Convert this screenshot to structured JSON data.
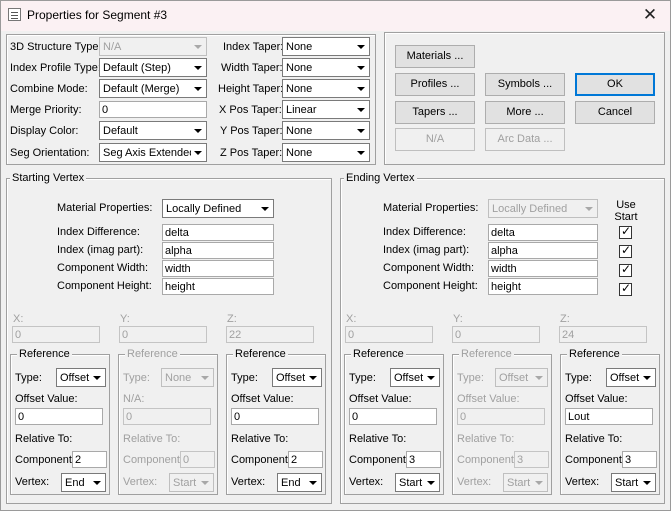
{
  "window": {
    "title": "Properties for Segment #3",
    "close_glyph": "✕"
  },
  "segment": {
    "labels": {
      "structure_type": "3D Structure Type:",
      "index_profile_type": "Index Profile Type:",
      "combine_mode": "Combine Mode:",
      "merge_priority": "Merge Priority:",
      "display_color": "Display Color:",
      "seg_orientation": "Seg Orientation:",
      "index_taper": "Index Taper:",
      "width_taper": "Width Taper:",
      "height_taper": "Height Taper:",
      "x_pos_taper": "X Pos Taper:",
      "y_pos_taper": "Y Pos Taper:",
      "z_pos_taper": "Z Pos Taper:"
    },
    "values": {
      "structure_type": "N/A",
      "index_profile_type": "Default (Step)",
      "combine_mode": "Default (Merge)",
      "merge_priority": "0",
      "display_color": "Default",
      "seg_orientation": "Seg Axis Extended",
      "index_taper": "None",
      "width_taper": "None",
      "height_taper": "None",
      "x_pos_taper": "Linear",
      "y_pos_taper": "None",
      "z_pos_taper": "None"
    }
  },
  "buttons": {
    "materials": "Materials ...",
    "profiles": "Profiles ...",
    "symbols": "Symbols ...",
    "ok": "OK",
    "tapers": "Tapers ...",
    "more": "More ...",
    "cancel": "Cancel",
    "na": "N/A",
    "arc_data": "Arc Data ..."
  },
  "starting_vertex": {
    "title": "Starting Vertex",
    "material_properties_label": "Material Properties:",
    "material_properties": "Locally Defined",
    "index_difference_label": "Index Difference:",
    "index_difference": "delta",
    "index_imag_label": "Index (imag part):",
    "index_imag": "alpha",
    "component_width_label": "Component Width:",
    "component_width": "width",
    "component_height_label": "Component Height:",
    "component_height": "height",
    "x_label": "X:",
    "x": "0",
    "y_label": "Y:",
    "y": "0",
    "z_label": "Z:",
    "z": "22",
    "refs": [
      {
        "title": "Reference",
        "type_label": "Type:",
        "type": "Offset",
        "value_label": "Offset Value:",
        "value": "0",
        "relative_label": "Relative To:",
        "component_label": "Component:",
        "component": "2",
        "vertex_label": "Vertex:",
        "vertex": "End"
      },
      {
        "title": "Reference",
        "type_label": "Type:",
        "type": "None",
        "value_label": "N/A:",
        "value": "0",
        "relative_label": "Relative To:",
        "component_label": "Component:",
        "component": "0",
        "vertex_label": "Vertex:",
        "vertex": "Start"
      },
      {
        "title": "Reference",
        "type_label": "Type:",
        "type": "Offset",
        "value_label": "Offset Value:",
        "value": "0",
        "relative_label": "Relative To:",
        "component_label": "Component:",
        "component": "2",
        "vertex_label": "Vertex:",
        "vertex": "End"
      }
    ]
  },
  "ending_vertex": {
    "title": "Ending Vertex",
    "use_start_label": "Use Start",
    "material_properties_label": "Material Properties:",
    "material_properties": "Locally Defined",
    "index_difference_label": "Index Difference:",
    "index_difference": "delta",
    "index_imag_label": "Index (imag part):",
    "index_imag": "alpha",
    "component_width_label": "Component Width:",
    "component_width": "width",
    "component_height_label": "Component Height:",
    "component_height": "height",
    "use_start": {
      "index_difference": true,
      "index_imag": true,
      "component_width": true,
      "component_height": true
    },
    "x_label": "X:",
    "x": "0",
    "y_label": "Y:",
    "y": "0",
    "z_label": "Z:",
    "z": "24",
    "refs": [
      {
        "title": "Reference",
        "type_label": "Type:",
        "type": "Offset",
        "value_label": "Offset Value:",
        "value": "0",
        "relative_label": "Relative To:",
        "component_label": "Component:",
        "component": "3",
        "vertex_label": "Vertex:",
        "vertex": "Start"
      },
      {
        "title": "Reference",
        "type_label": "Type:",
        "type": "Offset",
        "value_label": "Offset Value:",
        "value": "0",
        "relative_label": "Relative To:",
        "component_label": "Component:",
        "component": "3",
        "vertex_label": "Vertex:",
        "vertex": "Start"
      },
      {
        "title": "Reference",
        "type_label": "Type:",
        "type": "Offset",
        "value_label": "Offset Value:",
        "value": "Lout",
        "relative_label": "Relative To:",
        "component_label": "Component:",
        "component": "3",
        "vertex_label": "Vertex:",
        "vertex": "Start"
      }
    ]
  }
}
